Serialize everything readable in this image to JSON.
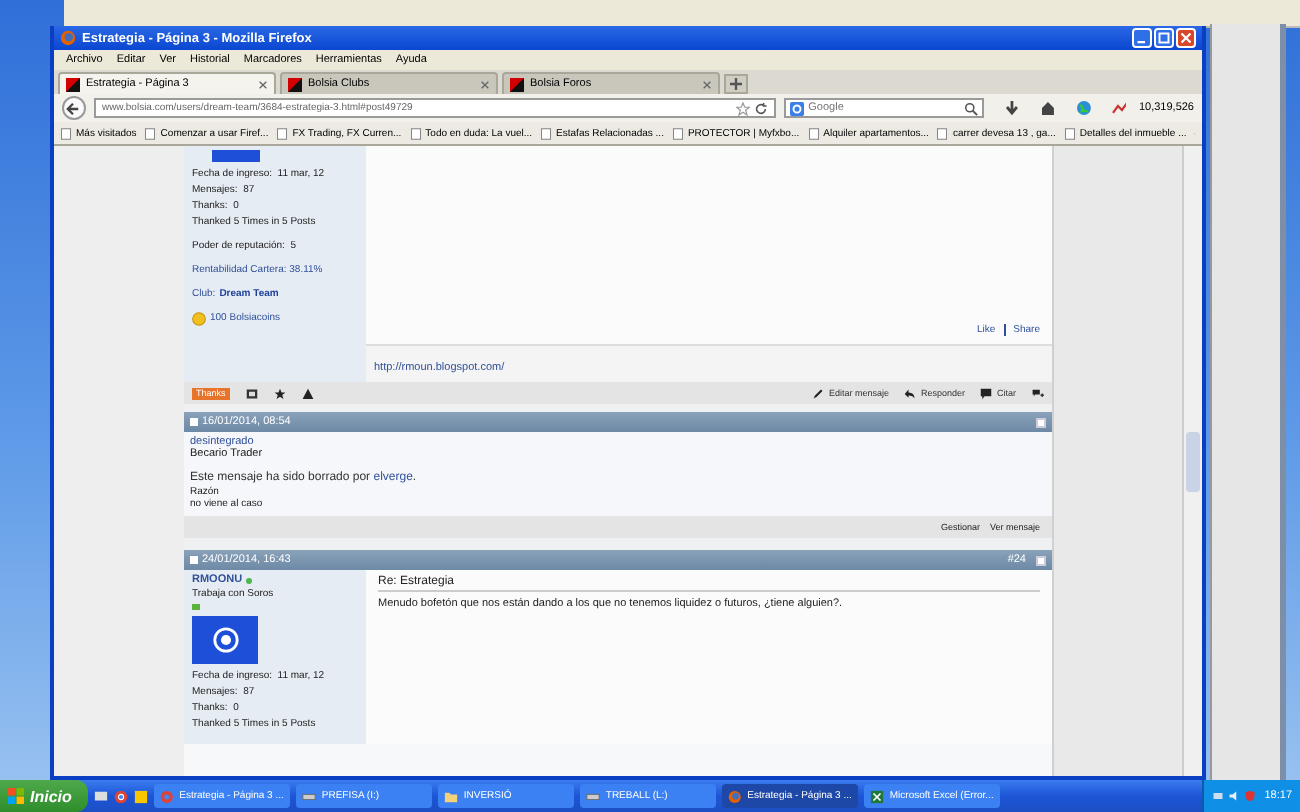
{
  "window": {
    "title": "Estrategia - Página 3 - Mozilla Firefox"
  },
  "menu": [
    "Archivo",
    "Editar",
    "Ver",
    "Historial",
    "Marcadores",
    "Herramientas",
    "Ayuda"
  ],
  "tabs": [
    {
      "label": "Estrategia - Página 3",
      "selected": true
    },
    {
      "label": "Bolsia Clubs",
      "selected": false
    },
    {
      "label": "Bolsia Foros",
      "selected": false
    }
  ],
  "address_bar": {
    "url": "www.bolsia.com/users/dream-team/3684-estrategia-3.html#post49729"
  },
  "search": {
    "placeholder": "Google"
  },
  "toolbar_counter": "10,319,526",
  "bookmarks": [
    "Más visitados",
    "Comenzar a usar Firef...",
    "FX Trading, FX Curren...",
    "Todo en duda: La vuel...",
    "Estafas Relacionadas ...",
    "PROTECTOR | Myfxbo...",
    "Alquiler apartamentos...",
    "carrer devesa 13 , ga...",
    "Detalles del inmueble ..."
  ],
  "post_top": {
    "stats": [
      {
        "label": "Fecha de ingreso:",
        "value": "11 mar, 12"
      },
      {
        "label": "Mensajes:",
        "value": "87"
      },
      {
        "label": "Thanks:",
        "value": "0"
      }
    ],
    "thanked": "Thanked 5 Times in 5 Posts",
    "reputation": {
      "label": "Poder de reputación:",
      "value": "5"
    },
    "portfolio": "Rentabilidad Cartera: 38.11%",
    "club": {
      "label": "Club:",
      "name": "Dream Team"
    },
    "coins": "100 Bolsiacoins",
    "social": [
      "Like",
      "Share"
    ],
    "signature": "http://rmoun.blogspot.com/",
    "thanks_button": "Thanks",
    "actions": [
      "Editar mensaje",
      "Responder",
      "Citar"
    ]
  },
  "deleted_post": {
    "date": "16/01/2014, 08:54",
    "username": "desintegrado",
    "user_title": "Becario Trader",
    "message": "Este mensaje ha sido borrado por",
    "deleted_by": "elverge",
    "message_end": ".",
    "reason_label": "Razón",
    "reason": "no viene al caso",
    "checked": false,
    "actions": [
      "Gestionar",
      "Ver mensaje"
    ]
  },
  "post_24": {
    "date": "24/01/2014, 16:43",
    "number": "#24",
    "username": "RMOONU",
    "online": true,
    "checked": false,
    "user_title": "Trabaja con Soros",
    "stats": [
      {
        "label": "Fecha de ingreso:",
        "value": "11 mar, 12"
      },
      {
        "label": "Mensajes:",
        "value": "87"
      },
      {
        "label": "Thanks:",
        "value": "0"
      }
    ],
    "thanked": "Thanked 5 Times in 5 Posts",
    "title": "Re: Estrategia",
    "body": "Menudo bofetón que nos están dando a los que no tenemos liquidez o futuros, ¿tiene alguien?."
  },
  "taskbar": {
    "start": "Inicio",
    "tasks": [
      {
        "label": "Estrategia - Página 3 ...",
        "kind": "chrome",
        "selected": false
      },
      {
        "label": "PREFISA (I:)",
        "kind": "drive",
        "selected": false
      },
      {
        "label": "INVERSIÓ",
        "kind": "folder",
        "selected": false
      },
      {
        "label": "TREBALL (L:)",
        "kind": "drive",
        "selected": false
      },
      {
        "label": "Estrategia - Página 3 ...",
        "kind": "firefox",
        "selected": true
      },
      {
        "label": "Microsoft Excel (Error...",
        "kind": "excel",
        "selected": false
      }
    ],
    "clock": "18:17"
  }
}
